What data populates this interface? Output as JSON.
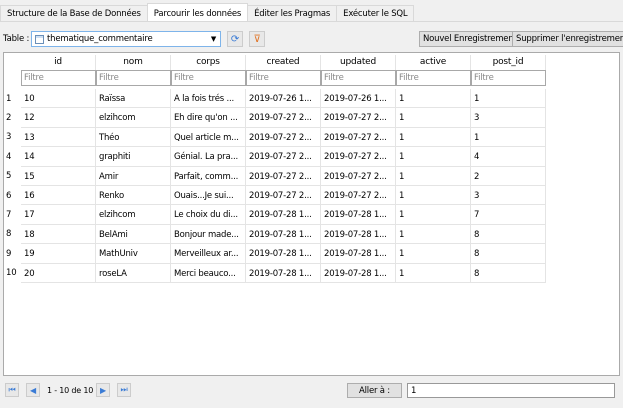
{
  "tabs": [
    "Structure de la Base de Données",
    "Parcourir les données",
    "Éditer les Pragmas",
    "Exécuter le SQL"
  ],
  "toolbar": {
    "table_label": "Table :",
    "table_value": "thematique_commentaire",
    "new_record": "Nouvel Enregistrement",
    "delete_record": "Supprimer l'enregistrement"
  },
  "columns": [
    "id",
    "nom",
    "corps",
    "created",
    "updated",
    "active",
    "post_id"
  ],
  "filter_placeholder": "Filtre",
  "rows": [
    [
      "1",
      "10",
      "Raïssa",
      "A la fois trés ...",
      "2019-07-26 1...",
      "2019-07-26 1...",
      "1",
      "1"
    ],
    [
      "2",
      "12",
      "elzihcom",
      "Eh dire qu'on ...",
      "2019-07-27 2...",
      "2019-07-27 2...",
      "1",
      "3"
    ],
    [
      "3",
      "13",
      "Théo",
      "Quel article m...",
      "2019-07-27 2...",
      "2019-07-27 2...",
      "1",
      "1"
    ],
    [
      "4",
      "14",
      "graphiti",
      "Génial. La pra...",
      "2019-07-27 2...",
      "2019-07-27 2...",
      "1",
      "4"
    ],
    [
      "5",
      "15",
      "Amir",
      "Parfait, comm...",
      "2019-07-27 2...",
      "2019-07-27 2...",
      "1",
      "2"
    ],
    [
      "6",
      "16",
      "Renko",
      "Ouais...Je sui...",
      "2019-07-27 2...",
      "2019-07-27 2...",
      "1",
      "3"
    ],
    [
      "7",
      "17",
      "elzihcom",
      "Le choix du di...",
      "2019-07-28 1...",
      "2019-07-28 1...",
      "1",
      "7"
    ],
    [
      "8",
      "18",
      "BelAmi",
      "Bonjour made...",
      "2019-07-28 1...",
      "2019-07-28 1...",
      "1",
      "8"
    ],
    [
      "9",
      "19",
      "MathUniv",
      "Merveilleux ar...",
      "2019-07-28 1...",
      "2019-07-28 1...",
      "1",
      "8"
    ],
    [
      "10",
      "20",
      "roseLA",
      "Merci beauco...",
      "2019-07-28 1...",
      "2019-07-28 1...",
      "1",
      "8"
    ]
  ],
  "footer": {
    "count": "1 - 10 de 10",
    "goto_label": "Aller à :",
    "goto_value": "1"
  }
}
